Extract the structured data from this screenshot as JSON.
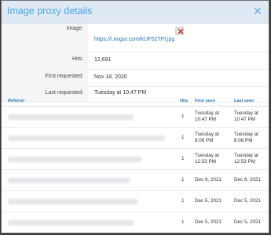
{
  "modal": {
    "title": "Image proxy details",
    "close_icon": "close-icon"
  },
  "details": {
    "image_label": "Image:",
    "image_url": "https://i.imgur.com/KUF52TPl.jpg",
    "broken_image_icon": "broken-image-icon",
    "hits_label": "Hits:",
    "hits_value": "12,691",
    "first_requested_label": "First requested:",
    "first_requested_value": "Nov 18, 2020",
    "last_requested_label": "Last requested:",
    "last_requested_value": "Tuesday at 10:47 PM"
  },
  "table": {
    "headers": [
      "Referrer",
      "Hits",
      "First seen",
      "Last seen"
    ],
    "rows": [
      {
        "hits": "1",
        "first_seen": "Tuesday at 10:47 PM",
        "last_seen": "Tuesday at 10:47 PM"
      },
      {
        "hits": "1",
        "first_seen": "Tuesday at 8:06 PM",
        "last_seen": "Tuesday at 8:06 PM"
      },
      {
        "hits": "1",
        "first_seen": "Tuesday at 12:53 PM",
        "last_seen": "Tuesday at 12:53 PM"
      },
      {
        "hits": "1",
        "first_seen": "Dec 6, 2021",
        "last_seen": "Dec 6, 2021"
      },
      {
        "hits": "1",
        "first_seen": "Dec 5, 2021",
        "last_seen": "Dec 5, 2021"
      },
      {
        "hits": "1",
        "first_seen": "Dec 5, 2021",
        "last_seen": "Dec 5, 2021"
      }
    ]
  },
  "colors": {
    "title": "#47a7eb",
    "link": "#2577b1",
    "header_bg": "#dfe9f4"
  }
}
